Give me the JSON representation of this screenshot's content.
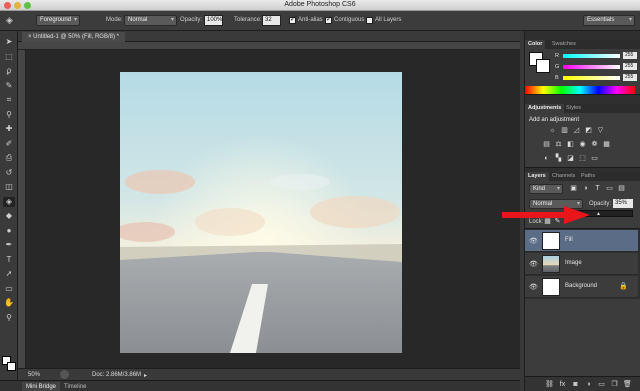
{
  "window": {
    "title": "Adobe Photoshop CS6",
    "traffic_lights": [
      "#ec5f57",
      "#e0b43f",
      "#5fbf48"
    ]
  },
  "options_bar": {
    "fill_mode_label": "Foreground",
    "mode_label": "Mode:",
    "mode_value": "Normal",
    "opacity_label": "Opacity:",
    "opacity_value": "100%",
    "tolerance_label": "Tolerance:",
    "tolerance_value": "32",
    "anti_alias_label": "Anti-alias",
    "contiguous_label": "Contiguous",
    "all_layers_label": "All Layers",
    "workspace_value": "Essentials"
  },
  "document": {
    "tab_label": "Untitled-1 @ 50% (Fill, RGB/8) *",
    "zoom": "50%",
    "doc_info": "Doc: 2.86M/3.86M"
  },
  "bottom_tabs": [
    "Mini Bridge",
    "Timeline"
  ],
  "tools": [
    "move-icon",
    "marquee-icon",
    "lasso-icon",
    "quick-select-icon",
    "crop-icon",
    "eyedropper-icon",
    "healing-brush-icon",
    "brush-icon",
    "clone-stamp-icon",
    "history-brush-icon",
    "eraser-icon",
    "paint-bucket-icon",
    "blur-icon",
    "dodge-icon",
    "pen-icon",
    "type-icon",
    "path-select-icon",
    "rectangle-icon",
    "hand-icon",
    "zoom-icon"
  ],
  "tool_glyphs": [
    "➤",
    "⬚",
    "ϼ",
    "✎",
    "⌗",
    "⚲",
    "✚",
    "✐",
    "⎙",
    "↺",
    "◫",
    "◈",
    "◆",
    "●",
    "✒",
    "T",
    "➚",
    "▭",
    "✋",
    "⚲"
  ],
  "color_panel": {
    "tabs": [
      "Color",
      "Swatches"
    ],
    "channels": [
      {
        "label": "R",
        "value": "255"
      },
      {
        "label": "G",
        "value": "255"
      },
      {
        "label": "B",
        "value": "255"
      }
    ]
  },
  "adjustments_panel": {
    "tabs": [
      "Adjustments",
      "Styles"
    ],
    "heading": "Add an adjustment"
  },
  "layers_panel": {
    "tabs": [
      "Layers",
      "Channels",
      "Paths"
    ],
    "kind_label": "Kind",
    "blend_mode": "Normal",
    "opacity_label": "Opacity:",
    "opacity_value": "35%",
    "lock_label": "Lock:",
    "layers": [
      {
        "name": "Fill",
        "selected": true
      },
      {
        "name": "Image",
        "selected": false
      },
      {
        "name": "Background",
        "selected": false
      }
    ]
  },
  "annotation": {
    "arrow_color": "#e8151b"
  }
}
